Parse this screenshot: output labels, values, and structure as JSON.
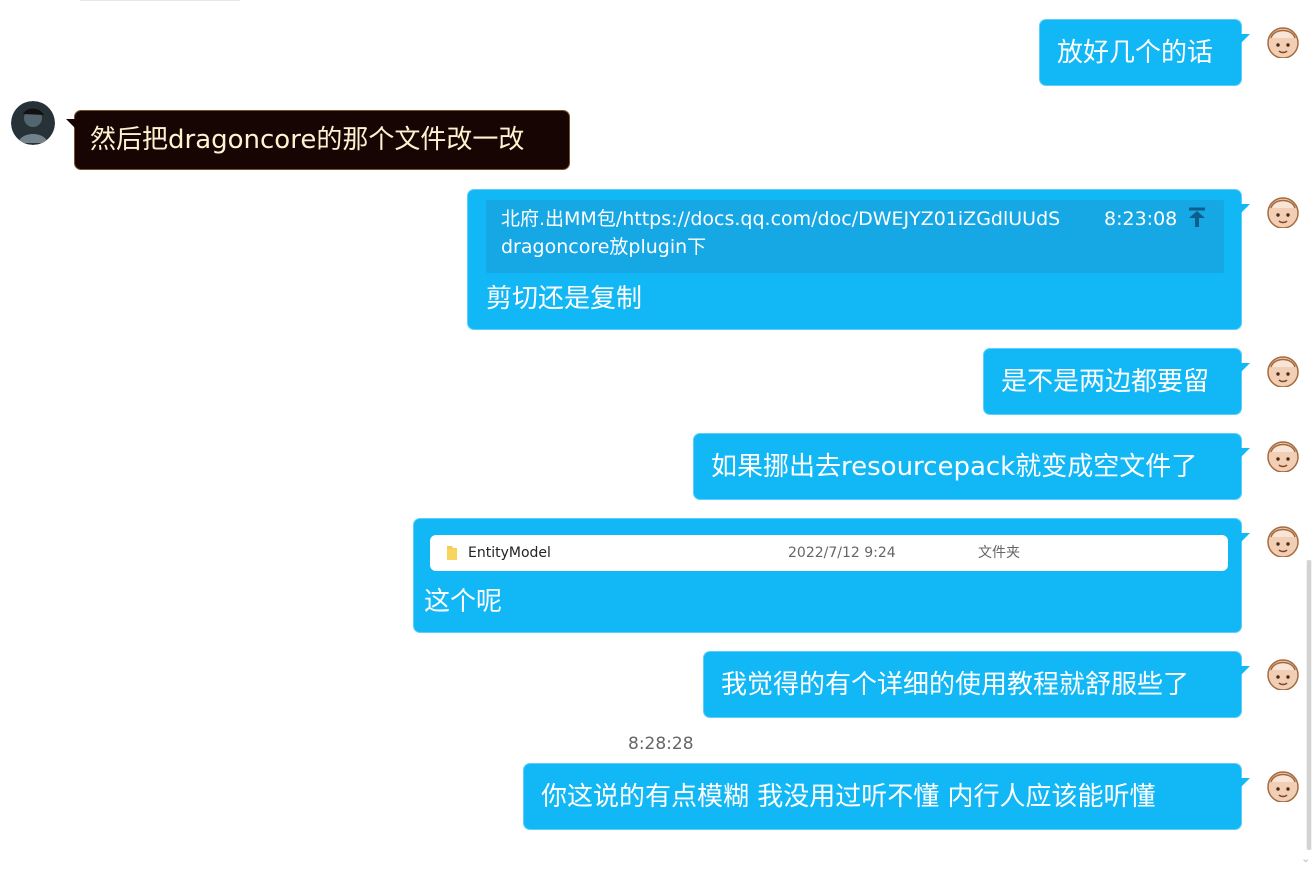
{
  "chat": {
    "timestamp": "8:28:28",
    "messages": [
      {
        "id": "m1",
        "sender": "self",
        "text": "放好几个的话"
      },
      {
        "id": "m2",
        "sender": "other",
        "text": "然后把dragoncore的那个文件改一改"
      },
      {
        "id": "m3",
        "sender": "self",
        "quote": {
          "line1": "北府.出MM包/https://docs.qq.com/doc/DWEJYZ01iZGdlUUdS",
          "time": "8:23:08",
          "line2": "dragoncore放plugin下"
        },
        "text": "剪切还是复制"
      },
      {
        "id": "m4",
        "sender": "self",
        "text": "是不是两边都要留"
      },
      {
        "id": "m5",
        "sender": "self",
        "text": "如果挪出去resourcepack就变成空文件了"
      },
      {
        "id": "m6",
        "sender": "self",
        "file": {
          "name": "EntityModel",
          "date": "2022/7/12 9:24",
          "type": "文件夹"
        },
        "text": "这个呢"
      },
      {
        "id": "m7",
        "sender": "self",
        "text": "我觉得的有个详细的使用教程就舒服些了"
      },
      {
        "id": "m8",
        "sender": "self",
        "text": "你这说的有点模糊   我没用过听不懂  内行人应该能听懂"
      }
    ]
  },
  "icons": {
    "self_avatar": "cartoon-avatar-icon",
    "other_avatar": "user-photo-avatar",
    "quote_jump": "arrow-up-to-line-icon",
    "file": "folder-icon",
    "scroll": "scroll-down-arrow-icon"
  },
  "colors": {
    "outgoing_bubble": "#12b7f5",
    "incoming_bubble": "#160503",
    "incoming_text": "#fff2cf",
    "quote_background": "#16a7e5"
  }
}
